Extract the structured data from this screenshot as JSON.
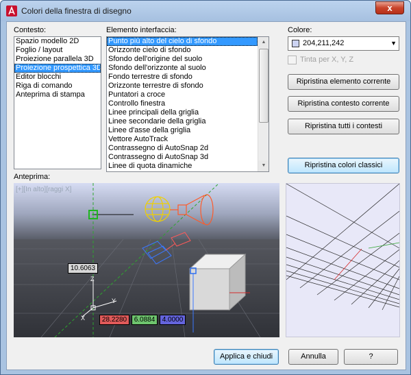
{
  "window": {
    "title": "Colori della finestra di disegno",
    "close_glyph": "x"
  },
  "context": {
    "label": "Contesto:",
    "items": [
      "Spazio modello 2D",
      "Foglio / layout",
      "Proiezione parallela 3D",
      "Proiezione prospettica 3D",
      "Editor blocchi",
      "Riga di comando",
      "Anteprima di stampa"
    ],
    "selected_index": 3
  },
  "interface": {
    "label": "Elemento interfaccia:",
    "items": [
      "Punto più alto del cielo di sfondo",
      "Orizzonte cielo di sfondo",
      "Sfondo dell'origine del suolo",
      "Sfondo dell'orizzonte al suolo",
      "Fondo terrestre di sfondo",
      "Orizzonte terrestre di sfondo",
      "Puntatori a croce",
      "Controllo finestra",
      "Linee principali della griglia",
      "Linee secondarie della griglia",
      "Linee d'asse della griglia",
      "Vettore AutoTrack",
      "Contrassegno di AutoSnap 2d",
      "Contrassegno di AutoSnap 3d",
      "Linee di quota dinamiche"
    ],
    "selected_index": 0
  },
  "color": {
    "label": "Colore:",
    "value": "204,211,242",
    "swatch": "#ccd3f2",
    "tint_label": "Tinta per X, Y, Z"
  },
  "buttons": {
    "restore_element": "Ripristina elemento corrente",
    "restore_context": "Ripristina contesto corrente",
    "restore_all": "Ripristina tutti i contesti",
    "restore_classic": "Ripristina colori classici",
    "apply_close": "Applica e chiudi",
    "cancel": "Annulla",
    "help": "?"
  },
  "preview": {
    "label": "Anteprima:",
    "view_label": "[+][In alto][raggi X]",
    "dim_value": "10.6063",
    "coord_x": "28.2280",
    "coord_y": "6.0884",
    "coord_z": "4.0000",
    "axis_z": "Z",
    "axis_y": "Y",
    "axis_x": "X",
    "colors": {
      "background": "#3b3d44",
      "coord_x_bg": "#e05a5a",
      "coord_y_bg": "#6ec46e",
      "coord_z_bg": "#6464dc"
    }
  }
}
